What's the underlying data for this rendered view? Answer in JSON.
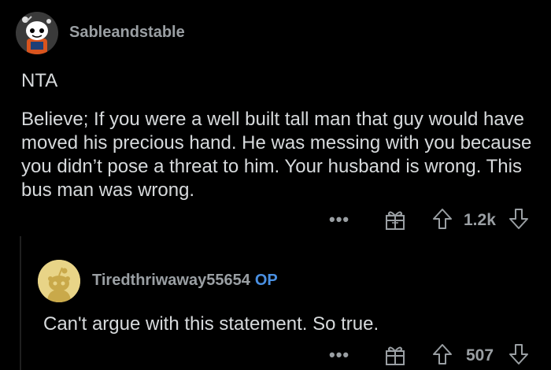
{
  "comment": {
    "username": "Sableandstable",
    "verdict": "NTA",
    "body": "Believe; If you were a well built tall man that guy would have moved his precious hand. He was messing with you because you didn’t pose a threat to him. Your husband is wrong. This bus man was wrong.",
    "more": "•••",
    "score": "1.2k"
  },
  "reply": {
    "username": "Tiredthriwaway55654",
    "op_badge": "OP",
    "body": "Can't argue with this statement. So true.",
    "more": "•••",
    "score": "507"
  },
  "colors": {
    "background": "#000000",
    "text": "#d7dadc",
    "muted": "#9a9fa3",
    "op_blue": "#4a90e2",
    "reply_avatar": "#e8d487"
  },
  "icons": [
    "snoo-avatar-icon",
    "award-gift-icon",
    "upvote-arrow-icon",
    "downvote-arrow-icon",
    "more-options-icon"
  ]
}
